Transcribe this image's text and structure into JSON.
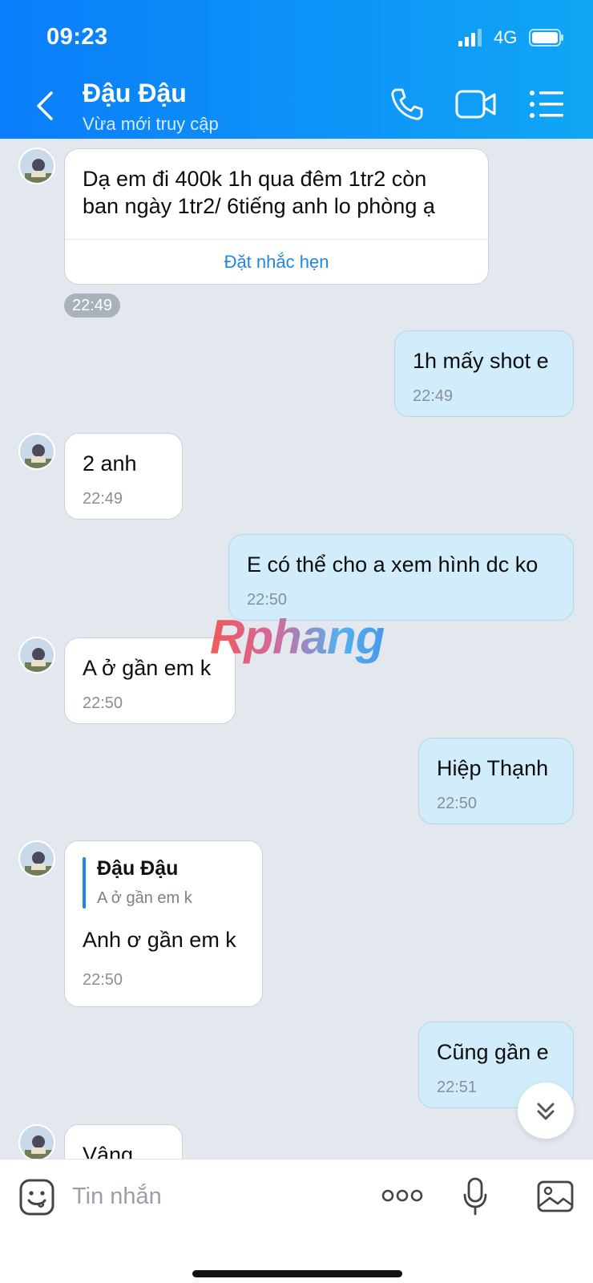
{
  "status_bar": {
    "time": "09:23",
    "network": "4G"
  },
  "header": {
    "contact_name": "Đậu Đậu",
    "contact_status": "Vừa mới truy cập"
  },
  "messages": [
    {
      "line1": "Dạ em đi 400k 1h  qua đêm 1tr2  còn",
      "line2": "ban ngày 1tr2/ 6tiếng  anh lo phòng ạ",
      "action": "Đặt nhắc hẹn",
      "time": "22:49"
    },
    {
      "text": "1h mấy shot e",
      "time": "22:49"
    },
    {
      "text": "2 anh",
      "time": "22:49"
    },
    {
      "text": "E có thể cho a xem hình dc ko",
      "time": "22:50"
    },
    {
      "text": "A ở gần em k",
      "time": "22:50"
    },
    {
      "text": "Hiệp Thạnh",
      "time": "22:50"
    },
    {
      "quote_name": "Đậu Đậu",
      "quote_text": "A ở gần em k",
      "text": "Anh ơ gần em k",
      "time": "22:50"
    },
    {
      "text": "Cũng gần e",
      "time": "22:51"
    },
    {
      "text": "Vâng"
    }
  ],
  "watermark": "Rphang",
  "input": {
    "placeholder": "Tin nhắn"
  },
  "colors": {
    "header_start": "#0a7dfa",
    "header_end": "#10a6f5",
    "outgoing_bubble": "#d1edfb",
    "link": "#1f86e6"
  }
}
